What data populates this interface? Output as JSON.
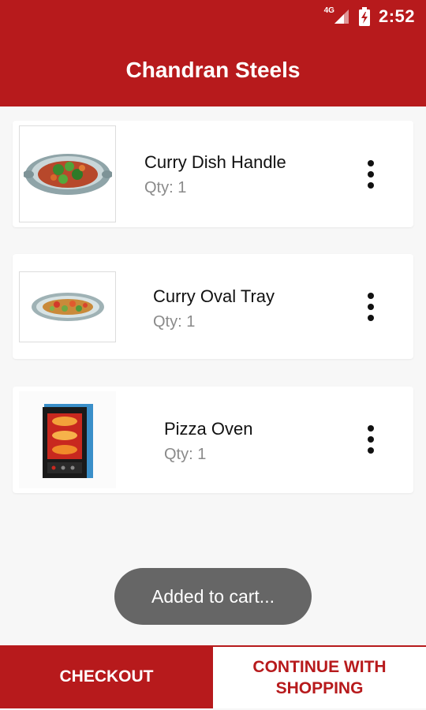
{
  "status_bar": {
    "network": "4G",
    "time": "2:52"
  },
  "app_bar": {
    "title": "Chandran Steels"
  },
  "cart": {
    "items": [
      {
        "name": "Curry Dish Handle",
        "qty": "Qty: 1",
        "image": "curry-dish-handle-image"
      },
      {
        "name": "Curry Oval Tray",
        "qty": "Qty: 1",
        "image": "curry-oval-tray-image"
      },
      {
        "name": "Pizza Oven",
        "qty": "Qty: 1",
        "image": "pizza-oven-image"
      }
    ]
  },
  "toast": {
    "message": "Added to cart..."
  },
  "bottom_bar": {
    "checkout_label": "CHECKOUT",
    "continue_label": "CONTINUE WITH SHOPPING"
  },
  "colors": {
    "primary": "#b71a1c",
    "toast": "#666666",
    "background": "#f7f7f7"
  },
  "icons": [
    "signal-icon",
    "battery-charging-icon",
    "more-vert-icon"
  ]
}
